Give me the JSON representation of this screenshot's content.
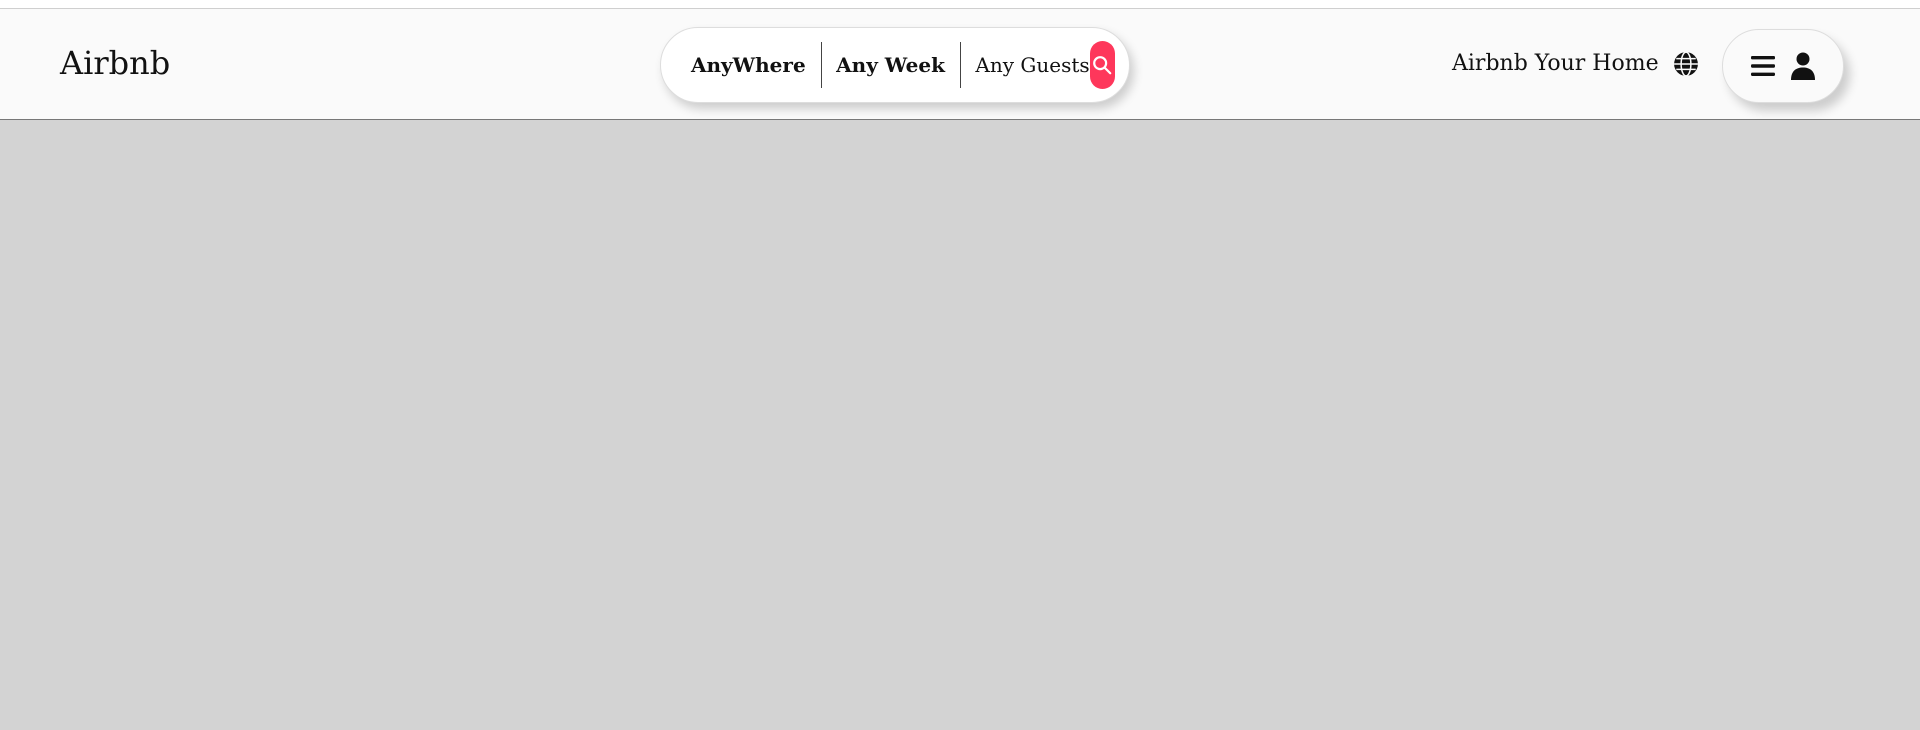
{
  "navbar": {
    "brand": "Airbnb",
    "search": {
      "location": "AnyWhere",
      "dates": "Any Week",
      "guests": "Any Guests",
      "button_icon": "search-icon",
      "button_color": "#fe375b"
    },
    "host_link": "Airbnb Your Home",
    "globe_icon": "globe-icon",
    "user_menu": {
      "menu_icon": "hamburger-icon",
      "user_icon": "user-icon"
    }
  },
  "main": {
    "background_color": "#d3d3d3"
  }
}
